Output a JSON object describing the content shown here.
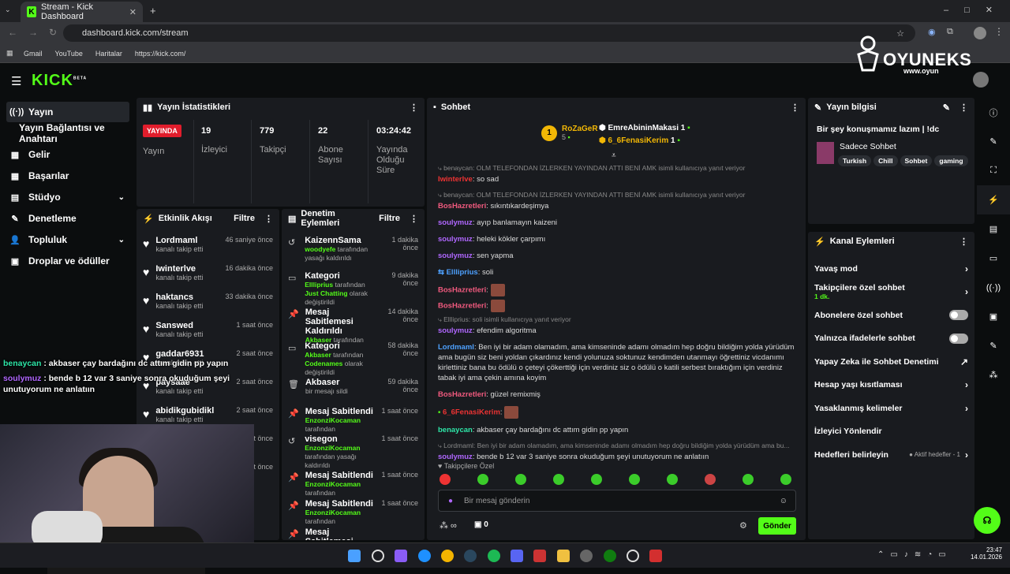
{
  "browser": {
    "tab_title": "Stream - Kick Dashboard",
    "url": "dashboard.kick.com/stream",
    "bookmarks": [
      "Gmail",
      "YouTube",
      "Haritalar",
      "https://kick.com/"
    ]
  },
  "watermark": {
    "name": "OYUNEKS",
    "sub": "www.oyun"
  },
  "logo": {
    "text": "KICK",
    "sup": "BETA"
  },
  "sidebar": {
    "items": [
      {
        "label": "Yayın",
        "icon": "((·))"
      },
      {
        "label": "Yayın Bağlantısı ve Anahtarı",
        "icon": ""
      },
      {
        "label": "Gelir",
        "icon": "▦"
      },
      {
        "label": "Başarılar",
        "icon": "▦"
      },
      {
        "label": "Stüdyo",
        "icon": "▤"
      },
      {
        "label": "Denetleme",
        "icon": "✎"
      },
      {
        "label": "Topluluk",
        "icon": "👤"
      },
      {
        "label": "Droplar ve ödüller",
        "icon": "▣"
      }
    ]
  },
  "stats": {
    "title": "Yayın İstatistikleri",
    "live": "YAYINDA",
    "live_label": "Yayın",
    "viewers": "19",
    "viewers_label": "İzleyici",
    "followers": "779",
    "followers_label": "Takipçi",
    "subs": "22",
    "subs_label": "Abone Sayısı",
    "uptime": "03:24:42",
    "uptime_label": "Yayında Olduğu Süre"
  },
  "activity": {
    "title": "Etkinlik Akışı",
    "filter": "Filtre",
    "items": [
      {
        "name": "Lordmaml",
        "sub": "kanalı takip etti",
        "time": "46 saniye önce"
      },
      {
        "name": "Iwinterlve",
        "sub": "kanalı takip etti",
        "time": "16 dakika önce"
      },
      {
        "name": "haktancs",
        "sub": "kanalı takip etti",
        "time": "33 dakika önce"
      },
      {
        "name": "Sanswed",
        "sub": "kanalı takip etti",
        "time": "1 saat önce"
      },
      {
        "name": "gaddar6931",
        "sub": "kanalı takip etti",
        "time": "2 saat önce"
      },
      {
        "name": "paysaae",
        "sub": "kanalı takip etti",
        "time": "2 saat önce"
      },
      {
        "name": "abidikgubidikl",
        "sub": "kanalı takip etti",
        "time": "2 saat önce"
      },
      {
        "name": "",
        "sub": "",
        "time": "3 saat önce"
      },
      {
        "name": "",
        "sub": "",
        "time": "3 saat önce"
      }
    ]
  },
  "modlog": {
    "title": "Denetim Eylemleri",
    "filter": "Filtre",
    "items": [
      {
        "icon": "↺",
        "title": "KaizennSama",
        "time": "1 dakika önce",
        "hl": "woodyefe",
        "desc": " tarafından yasağı kaldırıldı",
        "hl2": "",
        "desc2": ""
      },
      {
        "icon": "▭",
        "title": "Kategori",
        "time": "9 dakika önce",
        "hl": "Ellliprius",
        "desc": " tarafından ",
        "hl2": "Just Chatting",
        "desc2": " olarak değiştirildi"
      },
      {
        "icon": "📌",
        "title": "Mesaj Sabitlemesi Kaldırıldı",
        "time": "14 dakika önce",
        "hl": "Akbaser",
        "desc": " tarafından",
        "hl2": "",
        "desc2": ""
      },
      {
        "icon": "▭",
        "title": "Kategori",
        "time": "58 dakika önce",
        "hl": "Akbaser",
        "desc": " tarafından ",
        "hl2": "Codenames",
        "desc2": " olarak değiştirildi"
      },
      {
        "icon": "🗑",
        "title": "Akbaser",
        "time": "59 dakika önce",
        "hl": "",
        "desc": "bir mesajı sildi",
        "hl2": "",
        "desc2": ""
      },
      {
        "icon": "📌",
        "title": "Mesaj Sabitlendi",
        "time": "1 saat önce",
        "hl": "EnzonziKocaman",
        "desc": " tarafından",
        "hl2": "",
        "desc2": ""
      },
      {
        "icon": "↺",
        "title": "visegon",
        "time": "1 saat önce",
        "hl": "EnzonziKocaman",
        "desc": " tarafından yasağı kaldırıldı",
        "hl2": "",
        "desc2": ""
      },
      {
        "icon": "📌",
        "title": "Mesaj Sabitlendi",
        "time": "1 saat önce",
        "hl": "EnzonziKocaman",
        "desc": " tarafından",
        "hl2": "",
        "desc2": ""
      },
      {
        "icon": "📌",
        "title": "Mesaj Sabitlendi",
        "time": "1 saat önce",
        "hl": "EnzonziKocaman",
        "desc": " tarafından",
        "hl2": "",
        "desc2": ""
      },
      {
        "icon": "📌",
        "title": "Mesaj Sabitlemesi",
        "time": "",
        "hl": "",
        "desc": "",
        "hl2": "",
        "desc2": ""
      }
    ]
  },
  "chat": {
    "title": "Sohbet",
    "leaders": [
      {
        "name": "RoZaGeR",
        "count": "5"
      },
      {
        "name": "EmreAbininMakasi",
        "count": "1"
      },
      {
        "name": "6_6FenasiKerim",
        "count": "1"
      }
    ],
    "placeholder": "Bir mesaj gönderin",
    "followers_only": "Takipçilere Özel",
    "points": "0",
    "send": "Gönder"
  },
  "info": {
    "title": "Yayın bilgisi",
    "stream_title": "Bir şey konuşmamız lazım | !dc",
    "category": "Sadece Sohbet",
    "tags": [
      "Turkish",
      "Chill",
      "Sohbet",
      "gaming"
    ]
  },
  "channel": {
    "title": "Kanal Eylemleri",
    "rows": [
      {
        "label": "Yavaş mod",
        "sub": "",
        "ctl": "›"
      },
      {
        "label": "Takipçilere özel sohbet",
        "sub": "1 dk.",
        "ctl": "›"
      },
      {
        "label": "Abonelere özel sohbet",
        "sub": "",
        "ctl": "toggle"
      },
      {
        "label": "Yalnızca ifadelerle sohbet",
        "sub": "",
        "ctl": "toggle"
      },
      {
        "label": "Yapay Zeka ile Sohbet Denetimi",
        "sub": "",
        "ctl": "↗"
      },
      {
        "label": "Hesap yaşı kısıtlaması",
        "sub": "",
        "ctl": "›"
      },
      {
        "label": "Yasaklanmış kelimeler",
        "sub": "",
        "ctl": "›"
      },
      {
        "label": "İzleyici Yönlendir",
        "sub": "",
        "ctl": ""
      },
      {
        "label": "Hedefleri belirleyin",
        "sub": "",
        "ctl": "›"
      }
    ],
    "goals_note": "● Aktif hedefler - 1"
  },
  "overlay": {
    "line1_user": "benaycan",
    "line1_text": " : akbaser çay bardağını dc attım gidin pp yapın",
    "line2_user": "soulymuz",
    "line2_text": " : bende b 12 var 3 saniye sonra okuduğum şeyi unutuyorum ne anlatıın"
  },
  "clock": {
    "time": "23:47",
    "date": "14.01.2026"
  },
  "colors": {
    "accent": "#53fc18",
    "live": "#e11d2c",
    "panel": "#191b1f"
  }
}
